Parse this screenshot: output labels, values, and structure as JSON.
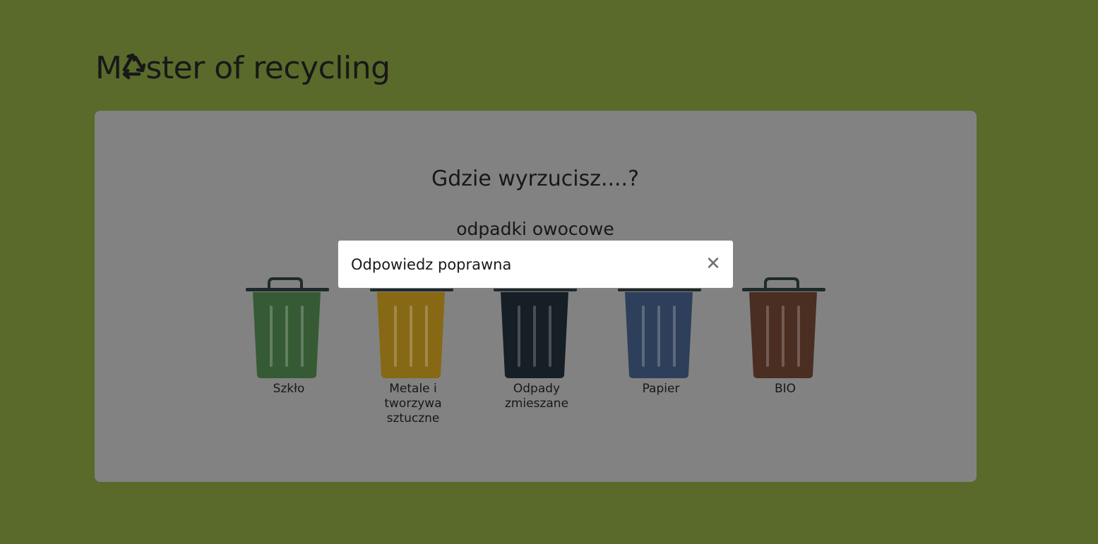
{
  "header": {
    "title_before_icon": "M",
    "title_icon": "recycle-icon",
    "title_after_icon": "ster of recycling"
  },
  "quiz": {
    "question": "Gdzie wyrzucisz....?",
    "item": "odpadki owocowe"
  },
  "bins": [
    {
      "label": "Szkło",
      "color": "#365a34"
    },
    {
      "label": "Metale i tworzywa sztuczne",
      "color": "#876814"
    },
    {
      "label": "Odpady zmieszane",
      "color": "#161e26"
    },
    {
      "label": "Papier",
      "color": "#2d3f5a"
    },
    {
      "label": "BIO",
      "color": "#4a2e22"
    }
  ],
  "modal": {
    "title": "Odpowiedz poprawna",
    "close_icon": "close-icon"
  },
  "colors": {
    "page_background": "#596a2b",
    "card_background": "#828282",
    "modal_background": "#ffffff"
  }
}
